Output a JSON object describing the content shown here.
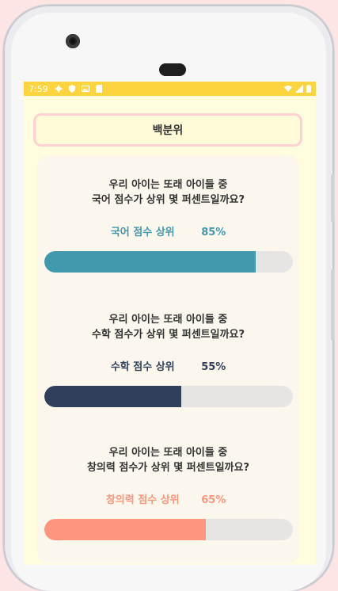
{
  "status": {
    "time": "7:59"
  },
  "header": {
    "title": "백분위"
  },
  "sections": [
    {
      "question_line1": "우리 아이는 또래 아이들 중",
      "question_line2": "국어 점수가 상위 몇 퍼센트일까요?",
      "label": "국어 점수 상위",
      "value_text": "85%",
      "percent": 85,
      "color": "#4199ae"
    },
    {
      "question_line1": "우리 아이는 또래 아이들 중",
      "question_line2": "수학 점수가 상위 몇 퍼센트일까요?",
      "label": "수학 점수 상위",
      "value_text": "55%",
      "percent": 55,
      "color": "#30405c"
    },
    {
      "question_line1": "우리 아이는 또래 아이들 중",
      "question_line2": "창의력 점수가 상위 몇 퍼센트일까요?",
      "label": "창의력 점수 상위",
      "value_text": "65%",
      "percent": 65,
      "color": "#fe957e"
    }
  ],
  "icons": [
    "settings-icon",
    "shield-icon",
    "image-icon",
    "sd-card-icon",
    "wifi-icon",
    "signal-icon",
    "battery-icon"
  ]
}
